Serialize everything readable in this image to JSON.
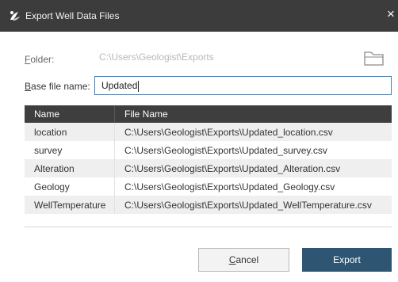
{
  "window": {
    "title": "Export Well Data Files",
    "close_glyph": "×",
    "icon": "app-logo-icon"
  },
  "folder": {
    "label_ul": "F",
    "label_rest": "older:",
    "value": "C:\\Users\\Geologist\\Exports",
    "enabled": false,
    "browse_icon": "folder-icon"
  },
  "base_file_name": {
    "label_ul": "B",
    "label_rest": "ase file name:",
    "value": "Updated"
  },
  "table": {
    "columns": [
      "Name",
      "File Name"
    ],
    "rows": [
      {
        "name": "location",
        "file": "C:\\Users\\Geologist\\Exports\\Updated_location.csv"
      },
      {
        "name": "survey",
        "file": "C:\\Users\\Geologist\\Exports\\Updated_survey.csv"
      },
      {
        "name": "Alteration",
        "file": "C:\\Users\\Geologist\\Exports\\Updated_Alteration.csv"
      },
      {
        "name": "Geology",
        "file": "C:\\Users\\Geologist\\Exports\\Updated_Geology.csv"
      },
      {
        "name": "WellTemperature",
        "file": "C:\\Users\\Geologist\\Exports\\Updated_WellTemperature.csv"
      }
    ]
  },
  "buttons": {
    "cancel_ul": "C",
    "cancel_rest": "ancel",
    "export": "Export"
  },
  "colors": {
    "titlebar": "#3c3c3c",
    "table_header": "#3e3e3e",
    "primary_button": "#2e5572",
    "input_focus_border": "#4f7cab"
  }
}
